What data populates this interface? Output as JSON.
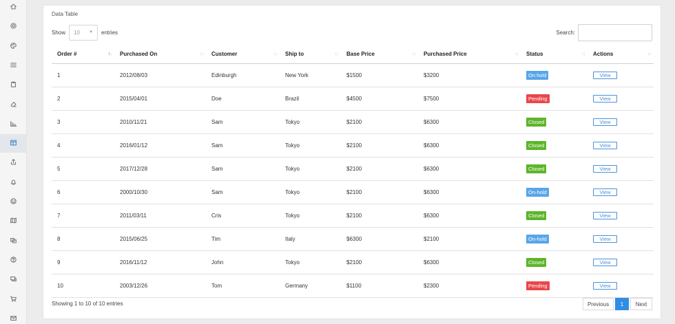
{
  "card": {
    "title": "Data Table"
  },
  "length": {
    "show_label": "Show",
    "value": "10",
    "entries_label": "entries"
  },
  "search": {
    "label": "Search:",
    "value": ""
  },
  "columns": [
    "Order #",
    "Purchased On",
    "Customer",
    "Ship to",
    "Base Price",
    "Purchased Price",
    "Status",
    "Actions"
  ],
  "rows": [
    {
      "order": "1",
      "date": "2012/08/03",
      "customer": "Edinburgh",
      "ship_to": "New York",
      "base": "$1500",
      "purchased": "$3200",
      "status": "On hold",
      "action": "View"
    },
    {
      "order": "2",
      "date": "2015/04/01",
      "customer": "Doe",
      "ship_to": "Brazil",
      "base": "$4500",
      "purchased": "$7500",
      "status": "Pending",
      "action": "View"
    },
    {
      "order": "3",
      "date": "2010/11/21",
      "customer": "Sam",
      "ship_to": "Tokyo",
      "base": "$2100",
      "purchased": "$6300",
      "status": "Closed",
      "action": "View"
    },
    {
      "order": "4",
      "date": "2016/01/12",
      "customer": "Sam",
      "ship_to": "Tokyo",
      "base": "$2100",
      "purchased": "$6300",
      "status": "Closed",
      "action": "View"
    },
    {
      "order": "5",
      "date": "2017/12/28",
      "customer": "Sam",
      "ship_to": "Tokyo",
      "base": "$2100",
      "purchased": "$6300",
      "status": "Closed",
      "action": "View"
    },
    {
      "order": "6",
      "date": "2000/10/30",
      "customer": "Sam",
      "ship_to": "Tokyo",
      "base": "$2100",
      "purchased": "$6300",
      "status": "On-hold",
      "action": "View"
    },
    {
      "order": "7",
      "date": "2011/03/11",
      "customer": "Cris",
      "ship_to": "Tokyo",
      "base": "$2100",
      "purchased": "$6300",
      "status": "Closed",
      "action": "View"
    },
    {
      "order": "8",
      "date": "2015/06/25",
      "customer": "Tim",
      "ship_to": "Italy",
      "base": "$6300",
      "purchased": "$2100",
      "status": "On-hold",
      "action": "View"
    },
    {
      "order": "9",
      "date": "2016/11/12",
      "customer": "John",
      "ship_to": "Tokyo",
      "base": "$2100",
      "purchased": "$6300",
      "status": "Closed",
      "action": "View"
    },
    {
      "order": "10",
      "date": "2003/12/26",
      "customer": "Tom",
      "ship_to": "Germany",
      "base": "$1100",
      "purchased": "$2300",
      "status": "Pending",
      "action": "View"
    }
  ],
  "status_colors": {
    "On hold": "#58a6e8",
    "On-hold": "#58a6e8",
    "Pending": "#e9474a",
    "Closed": "#5cb52a"
  },
  "footer": {
    "info": "Showing 1 to 10 of 10 entries"
  },
  "pagination": {
    "previous": "Previous",
    "page": "1",
    "next": "Next"
  },
  "sidebar": {
    "icons": [
      "home-icon",
      "gear-icon",
      "palette-icon",
      "list-icon",
      "clipboard-icon",
      "eraser-icon",
      "bar-chart-icon",
      "layout-icon",
      "share-icon",
      "bell-icon",
      "smile-icon",
      "map-icon",
      "copy-icon",
      "help-icon",
      "chat-icon",
      "cart-icon",
      "mail-icon"
    ],
    "active": "layout-icon"
  }
}
